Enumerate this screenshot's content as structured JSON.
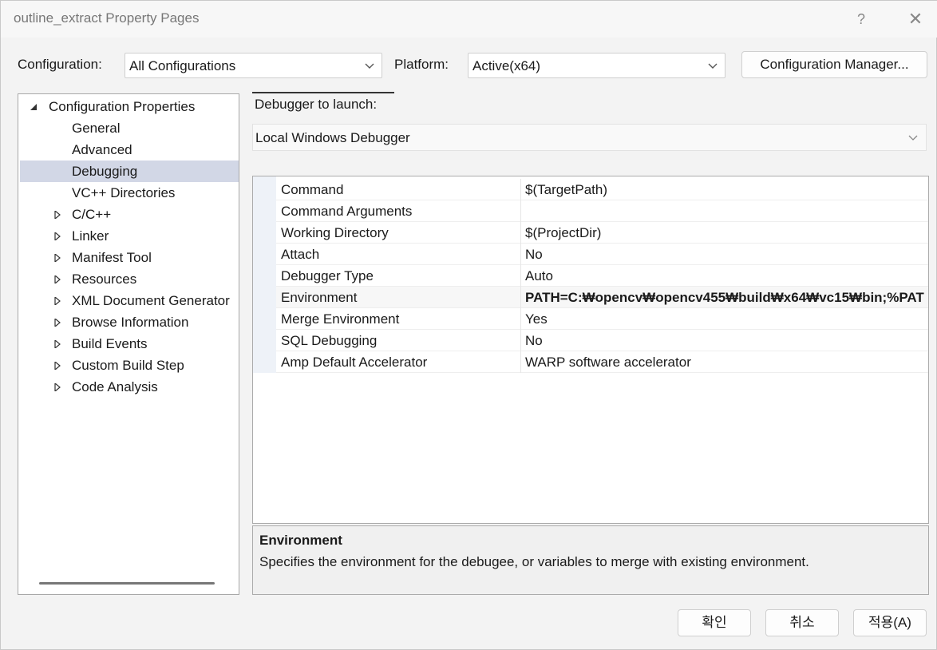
{
  "window": {
    "title": "outline_extract Property Pages",
    "help_glyph": "?",
    "close_glyph": "✕"
  },
  "toolbar": {
    "configuration_label": "Configuration:",
    "configuration_value": "All Configurations",
    "platform_label": "Platform:",
    "platform_value": "Active(x64)",
    "config_manager_label": "Configuration Manager..."
  },
  "tree": {
    "root": "Configuration Properties",
    "items": [
      {
        "label": "General",
        "expandable": false
      },
      {
        "label": "Advanced",
        "expandable": false
      },
      {
        "label": "Debugging",
        "expandable": false,
        "selected": true
      },
      {
        "label": "VC++ Directories",
        "expandable": false
      },
      {
        "label": "C/C++",
        "expandable": true
      },
      {
        "label": "Linker",
        "expandable": true
      },
      {
        "label": "Manifest Tool",
        "expandable": true
      },
      {
        "label": "Resources",
        "expandable": true
      },
      {
        "label": "XML Document Generator",
        "expandable": true
      },
      {
        "label": "Browse Information",
        "expandable": true
      },
      {
        "label": "Build Events",
        "expandable": true
      },
      {
        "label": "Custom Build Step",
        "expandable": true
      },
      {
        "label": "Code Analysis",
        "expandable": true
      }
    ]
  },
  "debugger": {
    "launch_label": "Debugger to launch:",
    "launch_value": "Local Windows Debugger"
  },
  "properties": [
    {
      "name": "Command",
      "value": "$(TargetPath)"
    },
    {
      "name": "Command Arguments",
      "value": ""
    },
    {
      "name": "Working Directory",
      "value": "$(ProjectDir)"
    },
    {
      "name": "Attach",
      "value": "No"
    },
    {
      "name": "Debugger Type",
      "value": "Auto"
    },
    {
      "name": "Environment",
      "value": "PATH=C:₩opencv₩opencv455₩build₩x64₩vc15₩bin;%PAT",
      "bold": true,
      "selected": true
    },
    {
      "name": "Merge Environment",
      "value": "Yes"
    },
    {
      "name": "SQL Debugging",
      "value": "No"
    },
    {
      "name": "Amp Default Accelerator",
      "value": "WARP software accelerator"
    }
  ],
  "description": {
    "title": "Environment",
    "text": "Specifies the environment for the debugee, or variables to merge with existing environment."
  },
  "footer": {
    "ok_label": "확인",
    "cancel_label": "취소",
    "apply_label": "적용(A)"
  }
}
